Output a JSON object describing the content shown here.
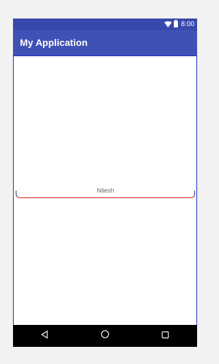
{
  "status_bar": {
    "time": "8:00",
    "icons": [
      "wifi-icon",
      "battery-icon"
    ]
  },
  "app_bar": {
    "title": "My Application"
  },
  "text_field": {
    "value": "Nilesh"
  },
  "navigation": {
    "buttons": [
      "back-icon",
      "home-icon",
      "recents-icon"
    ]
  },
  "colors": {
    "status_bar": "#3949ab",
    "app_bar": "#3f51b5",
    "field_underline": "#d01b1b",
    "content_border": "#1a2bc8",
    "nav_bar": "#000000"
  }
}
